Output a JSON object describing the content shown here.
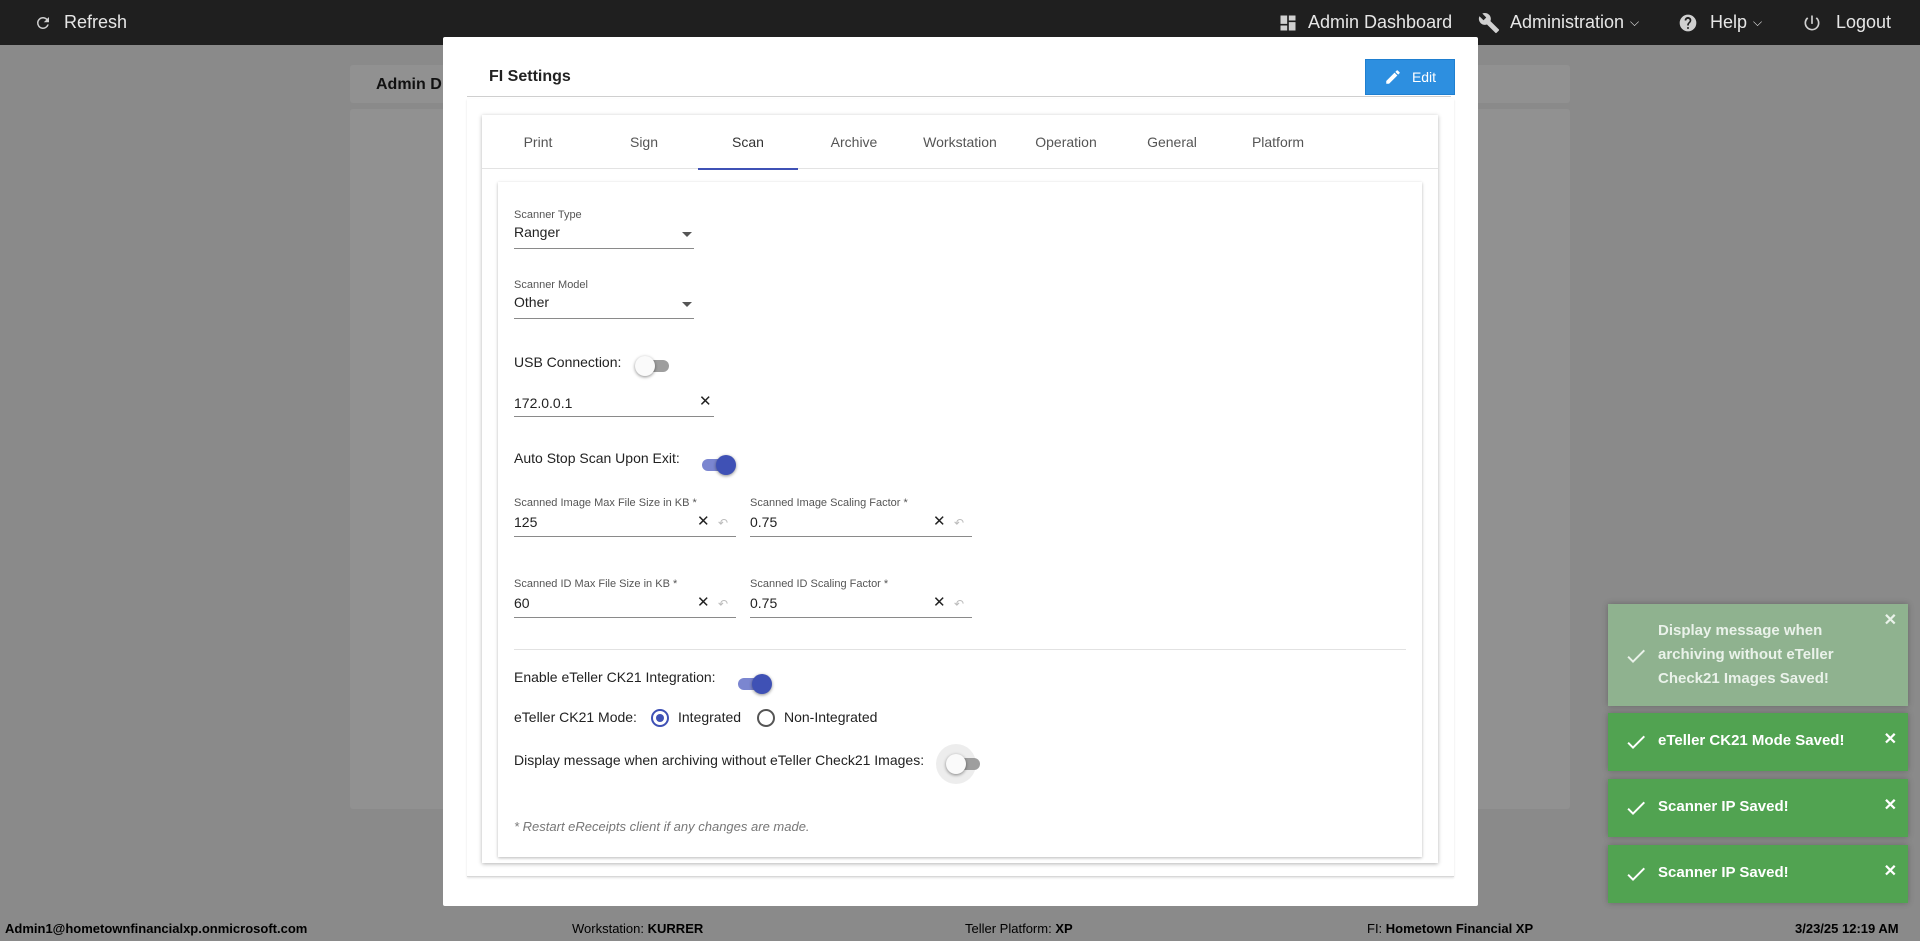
{
  "topbar": {
    "refresh_label": "Refresh",
    "admin_dashboard_label": "Admin Dashboard",
    "administration_label": "Administration",
    "help_label": "Help",
    "logout_label": "Logout"
  },
  "background": {
    "header_text": "Admin D"
  },
  "modal": {
    "title": "FI Settings",
    "edit_label": "Edit",
    "tabs": [
      {
        "label": "Print"
      },
      {
        "label": "Sign"
      },
      {
        "label": "Scan"
      },
      {
        "label": "Archive"
      },
      {
        "label": "Workstation"
      },
      {
        "label": "Operation"
      },
      {
        "label": "General"
      },
      {
        "label": "Platform"
      }
    ],
    "active_tab": "Scan"
  },
  "scan": {
    "scanner_type": {
      "label": "Scanner Type",
      "value": "Ranger"
    },
    "scanner_model": {
      "label": "Scanner Model",
      "value": "Other"
    },
    "usb_connection": {
      "label": "USB Connection:",
      "on": false
    },
    "scanner_ip": {
      "value": "172.0.0.1"
    },
    "auto_stop": {
      "label": "Auto Stop Scan Upon Exit:",
      "on": true
    },
    "image_max_size": {
      "label": "Scanned Image Max File Size in KB *",
      "value": "125"
    },
    "image_scaling": {
      "label": "Scanned Image Scaling Factor *",
      "value": "0.75"
    },
    "id_max_size": {
      "label": "Scanned ID Max File Size in KB *",
      "value": "60"
    },
    "id_scaling": {
      "label": "Scanned ID Scaling Factor *",
      "value": "0.75"
    },
    "ck21_enable": {
      "label": "Enable eTeller CK21 Integration:",
      "on": true
    },
    "ck21_mode": {
      "label": "eTeller CK21 Mode:",
      "options": [
        "Integrated",
        "Non-Integrated"
      ],
      "selected": "Integrated"
    },
    "display_message": {
      "label": "Display message when archiving without eTeller Check21 Images:",
      "on": false
    },
    "note": "* Restart eReceipts client if any changes are made."
  },
  "toasts": [
    {
      "message": "Display message when archiving without eTeller Check21 Images Saved!",
      "faded": true
    },
    {
      "message": "eTeller CK21 Mode Saved!",
      "faded": false
    },
    {
      "message": "Scanner IP Saved!",
      "faded": false
    },
    {
      "message": "Scanner IP Saved!",
      "faded": false
    }
  ],
  "statusbar": {
    "user": "Admin1@hometownfinancialxp.onmicrosoft.com",
    "workstation_label": "Workstation:",
    "workstation_value": "KURRER",
    "platform_label": "Teller Platform:",
    "platform_value": "XP",
    "fi_label": "FI:",
    "fi_value": "Hometown Financial XP",
    "datetime": "3/23/25 12:19 AM"
  },
  "colors": {
    "accent": "#3f51b5",
    "edit_button": "#2d8fe0",
    "toast_success": "#51a351"
  }
}
